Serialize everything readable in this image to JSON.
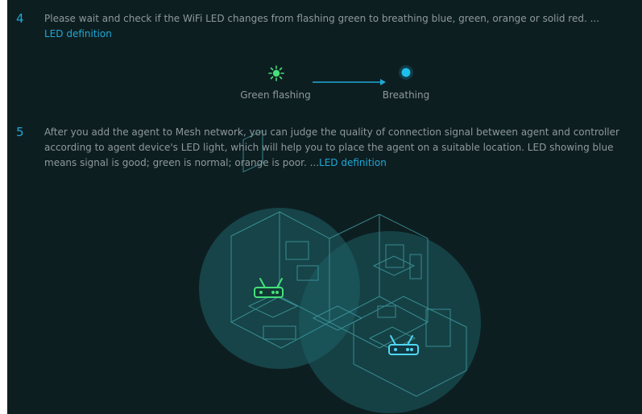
{
  "steps": [
    {
      "number": "4",
      "text": "Please wait and check if the WiFi LED changes from flashing green to breathing blue, green, orange or solid red. ...",
      "link": "LED definition"
    },
    {
      "number": "5",
      "text": "After you add the agent to Mesh network, you can judge the quality of connection signal between agent and controller according to agent device's LED light, which will help you to place the agent on a suitable location. LED showing blue means signal is good; green is normal; orange is poor. ...",
      "link": "LED definition"
    }
  ],
  "led_states": {
    "from": {
      "label": "Green flashing",
      "color": "#45e07a",
      "icon": "green-flashing-led-icon"
    },
    "to": {
      "label": "Breathing",
      "color": "#1fc0ec",
      "icon": "breathing-blue-led-icon"
    },
    "arrow_color": "#1ea9d6"
  },
  "illustration": {
    "description_icon": "mesh-home-illustration",
    "controller_router_color": "#45e07a",
    "agent_router_color": "#4fd6f2",
    "coverage_color": "#1f6469"
  },
  "colors": {
    "background": "#0d1e21",
    "accent": "#1ea9d6",
    "body_text": "#8e999b"
  }
}
